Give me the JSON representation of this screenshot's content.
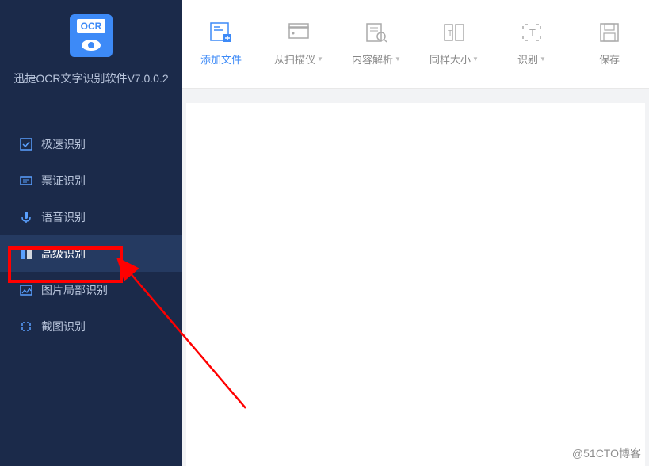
{
  "logo": {
    "text": "OCR"
  },
  "app_title": "迅捷OCR文字识别软件V7.0.0.2",
  "sidebar": {
    "items": [
      {
        "label": "极速识别",
        "icon": "speed-icon"
      },
      {
        "label": "票证识别",
        "icon": "ticket-icon"
      },
      {
        "label": "语音识别",
        "icon": "voice-icon"
      },
      {
        "label": "高级识别",
        "icon": "advanced-icon"
      },
      {
        "label": "图片局部识别",
        "icon": "image-part-icon"
      },
      {
        "label": "截图识别",
        "icon": "screenshot-icon"
      }
    ]
  },
  "toolbar": {
    "items": [
      {
        "label": "添加文件",
        "has_dropdown": false,
        "primary": true
      },
      {
        "label": "从扫描仪",
        "has_dropdown": true,
        "primary": false
      },
      {
        "label": "内容解析",
        "has_dropdown": true,
        "primary": false
      },
      {
        "label": "同样大小",
        "has_dropdown": true,
        "primary": false
      },
      {
        "label": "识别",
        "has_dropdown": true,
        "primary": false
      },
      {
        "label": "保存",
        "has_dropdown": false,
        "primary": false
      }
    ]
  },
  "watermark": "@51CTO博客"
}
